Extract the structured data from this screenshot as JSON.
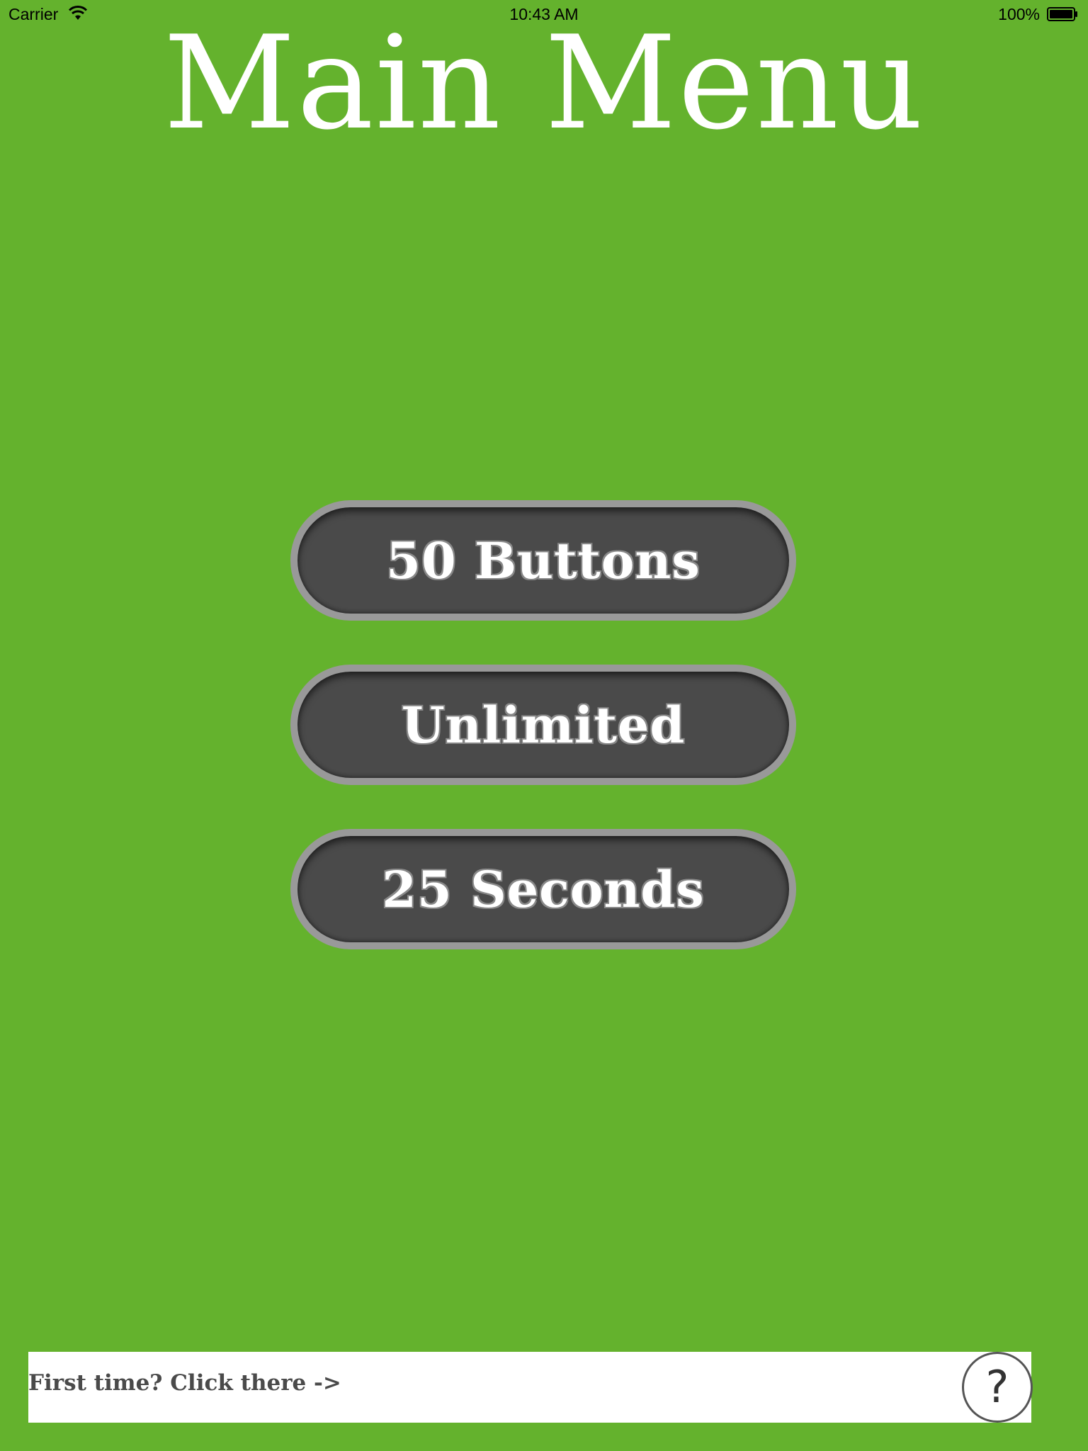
{
  "status_bar": {
    "carrier": "Carrier",
    "time": "10:43 AM",
    "battery": "100%",
    "wifi_icon": "wifi-icon",
    "battery_icon": "battery-icon"
  },
  "title": "Main Menu",
  "menu": {
    "buttons": [
      {
        "label": "50 Buttons"
      },
      {
        "label": "Unlimited"
      },
      {
        "label": "25 Seconds"
      }
    ]
  },
  "help_bar": {
    "text": "First time? Click there ->",
    "help_button_label": "?",
    "help_icon": "question-icon"
  },
  "colors": {
    "background": "#64b22d",
    "button_fill": "#4a4a4a",
    "button_border": "#999999",
    "text": "#ffffff"
  }
}
